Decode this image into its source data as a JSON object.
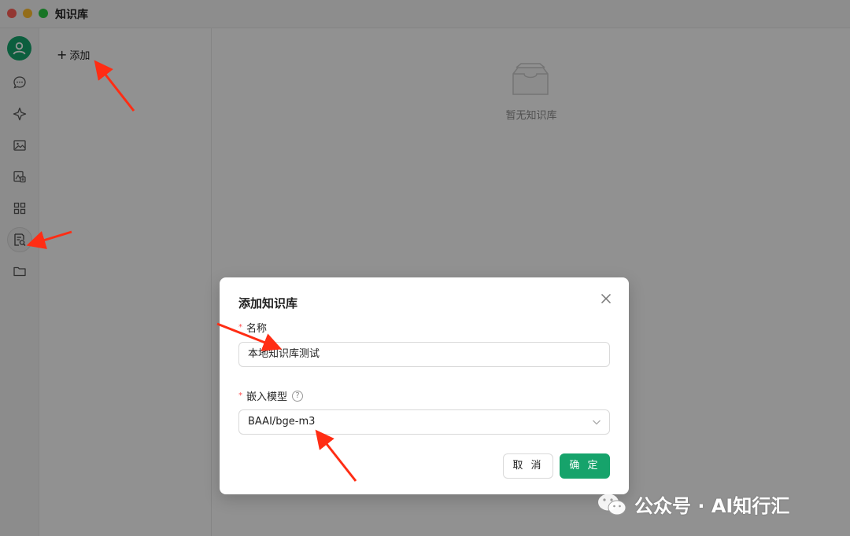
{
  "window": {
    "title": "知识库"
  },
  "list": {
    "add_label": "添加"
  },
  "main": {
    "empty_text": "暂无知识库"
  },
  "modal": {
    "title": "添加知识库",
    "name_label": "名称",
    "name_value": "本地知识库测试",
    "model_label": "嵌入模型",
    "model_value": "BAAI/bge-m3",
    "help": "?",
    "cancel_label": "取 消",
    "ok_label": "确 定"
  },
  "watermark": {
    "text": "公众号 · AI知行汇"
  },
  "colors": {
    "accent": "#16a36b",
    "arrow": "#ff2d14",
    "required": "#ff4d4f"
  },
  "icons": {
    "sidebar": [
      "user-avatar-icon",
      "chat-icon",
      "sparkle-icon",
      "image-icon",
      "image-translate-icon",
      "apps-grid-icon",
      "knowledge-base-icon",
      "folder-icon"
    ]
  }
}
